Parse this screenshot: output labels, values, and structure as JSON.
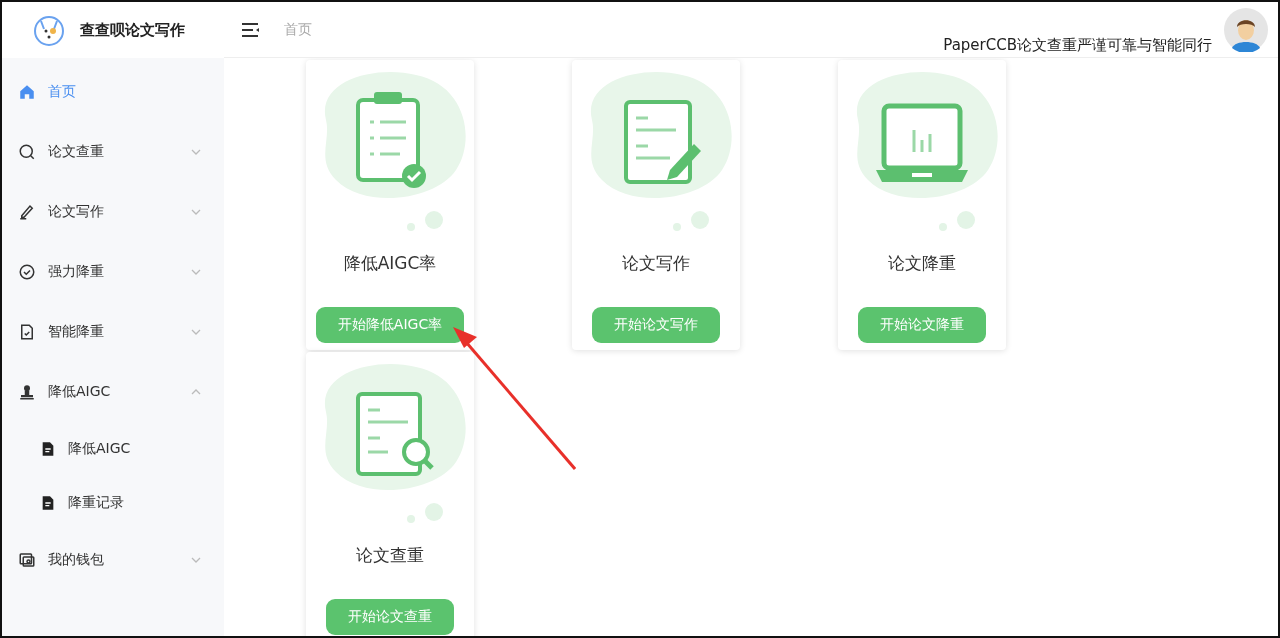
{
  "brand": {
    "name": "查查呗论文写作"
  },
  "header": {
    "breadcrumb": "首页",
    "slogan": "PaperCCB论文查重严谨可靠与智能同行"
  },
  "sidebar": {
    "items": [
      {
        "kind": "link",
        "label": "首页",
        "selected": true
      },
      {
        "kind": "group",
        "label": "论文查重",
        "expanded": false
      },
      {
        "kind": "group",
        "label": "论文写作",
        "expanded": false
      },
      {
        "kind": "group",
        "label": "强力降重",
        "expanded": false
      },
      {
        "kind": "group",
        "label": "智能降重",
        "expanded": false
      },
      {
        "kind": "group",
        "label": "降低AIGC",
        "expanded": true,
        "children": [
          {
            "label": "降低AIGC",
            "selected": false
          },
          {
            "label": "降重记录",
            "selected": false
          }
        ]
      },
      {
        "kind": "group",
        "label": "我的钱包",
        "expanded": false
      }
    ]
  },
  "cards": [
    {
      "title": "降低AIGC率",
      "button": "开始降低AIGC率"
    },
    {
      "title": "论文写作",
      "button": "开始论文写作"
    },
    {
      "title": "论文降重",
      "button": "开始论文降重"
    },
    {
      "title": "论文查重",
      "button": "开始论文查重"
    }
  ]
}
